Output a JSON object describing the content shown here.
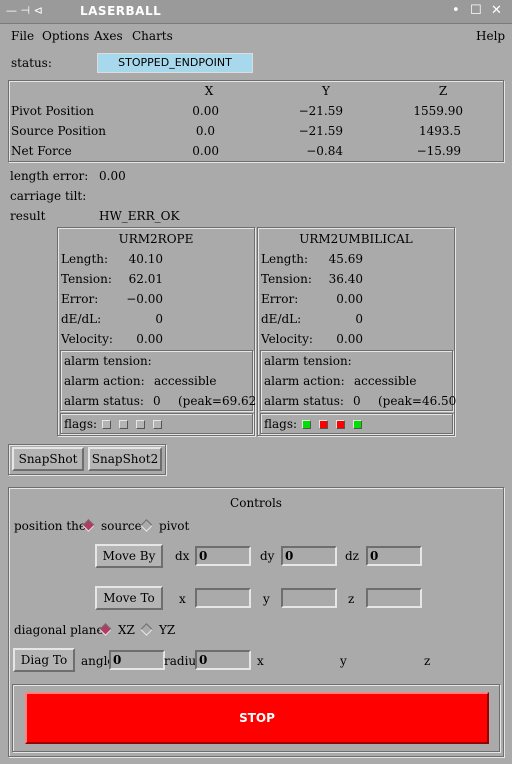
{
  "window": {
    "left_controls": "— ⊣ ⊲",
    "title": "LASERBALL",
    "btn_min": "•",
    "btn_max": "☐",
    "btn_close": "✕"
  },
  "menu": {
    "file": "File",
    "options": "Options",
    "axes": "Axes",
    "charts": "Charts",
    "help": "Help"
  },
  "status": {
    "label": "status:",
    "value": "STOPPED_ENDPOINT"
  },
  "positions": {
    "headers": [
      "X",
      "Y",
      "Z"
    ],
    "rows": [
      {
        "label": "Pivot Position",
        "x": "0.00",
        "y": "−21.59",
        "z": "1559.90"
      },
      {
        "label": "Source Position",
        "x": "0.0",
        "y": "−21.59",
        "z": "1493.5"
      },
      {
        "label": "Net Force",
        "x": "0.00",
        "y": "−0.84",
        "z": "−15.99"
      }
    ]
  },
  "info": {
    "length_error_label": "length error:",
    "length_error_value": "0.00",
    "carriage_tilt_label": "carriage tilt:",
    "carriage_tilt_value": "",
    "result_label": "result",
    "result_value": "HW_ERR_OK"
  },
  "panels": [
    {
      "title": "URM2ROPE",
      "length_label": "Length:",
      "length": "40.10",
      "tension_label": "Tension:",
      "tension": "62.01",
      "error_label": "Error:",
      "error": "−0.00",
      "dedl_label": "dE/dL:",
      "dedl": "0",
      "velocity_label": "Velocity:",
      "velocity": "0.00",
      "alarm_tension_label": "alarm tension:",
      "alarm_action_label": "alarm action:",
      "alarm_action": "accessible",
      "alarm_status_label": "alarm status:",
      "alarm_status": "0",
      "peak": "(peak=69.62",
      "flags_label": "flags:",
      "flags": [
        "#b4b4b4",
        "#b4b4b4",
        "#b4b4b4",
        "#b4b4b4"
      ]
    },
    {
      "title": "URM2UMBILICAL",
      "length_label": "Length:",
      "length": "45.69",
      "tension_label": "Tension:",
      "tension": "36.40",
      "error_label": "Error:",
      "error": "0.00",
      "dedl_label": "dE/dL:",
      "dedl": "0",
      "velocity_label": "Velocity:",
      "velocity": "0.00",
      "alarm_tension_label": "alarm tension:",
      "alarm_action_label": "alarm action:",
      "alarm_action": "accessible",
      "alarm_status_label": "alarm status:",
      "alarm_status": "0",
      "peak": "(peak=46.50",
      "flags_label": "flags:",
      "flags": [
        "#00e000",
        "#ff0000",
        "#ff0000",
        "#00e000"
      ]
    }
  ],
  "snapshot": {
    "snapshot_label": "SnapShot",
    "snapshot2_label": "SnapShot2"
  },
  "controls": {
    "title": "Controls",
    "position_label": "position the",
    "source_label": "source",
    "pivot_label": "pivot",
    "selected_color": "#b03c64",
    "move_by_label": "Move By",
    "dx_label": "dx",
    "dx_value": "0",
    "dy_label": "dy",
    "dy_value": "0",
    "dz_label": "dz",
    "dz_value": "0",
    "move_to_label": "Move To",
    "x_label": "x",
    "x_value": "",
    "y_label": "y",
    "y_value": "",
    "z_label": "z",
    "z_value": "",
    "diagonal_label": "diagonal plane:",
    "xz_label": "XZ",
    "yz_label": "YZ",
    "diag_to_label": "Diag To",
    "angle_label": "angle",
    "angle_value": "0",
    "radius_label": "radius",
    "radius_value": "0",
    "diag_x_label": "x",
    "diag_y_label": "y",
    "diag_z_label": "z",
    "stop_label": "STOP",
    "stop_color": "#ff0000"
  }
}
